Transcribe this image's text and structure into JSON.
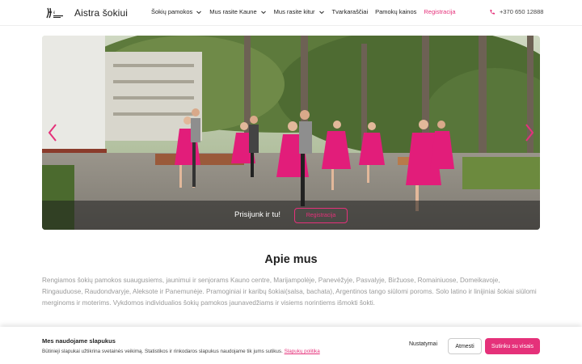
{
  "header": {
    "site_name": "Aistra šokiui",
    "nav": [
      {
        "label": "Šokių pamokos",
        "dropdown": true
      },
      {
        "label": "Mus rasite Kaune",
        "dropdown": true
      },
      {
        "label": "Mus rasite kitur",
        "dropdown": true
      },
      {
        "label": "Tvarkaraščiai",
        "dropdown": false
      },
      {
        "label": "Pamokų kainos",
        "dropdown": false
      },
      {
        "label": "Registracija",
        "dropdown": false,
        "accent": true
      }
    ],
    "phone": "+370 650 12888"
  },
  "hero": {
    "caption": "Prisijunk ir tu!",
    "button_label": "Registracija"
  },
  "about": {
    "title": "Apie mus",
    "text": "Rengiamos šokių pamokos suaugusiems, jaunimui ir senjorams Kauno centre, Marijampolėje, Panevėžyje, Pasvalyje, Biržuose, Romainiuose, Domeikavoje, Ringauduose, Raudondvaryje, Aleksote ir Panemunėje. Pramoginiai ir karibų šokiai(salsa, bachata), Argentinos tango siūlomi poroms. Solo latino ir linijiniai šokiai siūlomi merginoms ir moterims. Vykdomos individualios šokių pamokos jaunavedžiams ir visiems norintiems išmokti šokti."
  },
  "cookie": {
    "title": "Mes naudojame slapukus",
    "text": "Būtinieji slapukai užtikrina svetainės veikimą. Statistikos ir rinkodaros slapukus naudojame tik jums sutikus.",
    "link": "Slapukų politika",
    "settings_label": "Nustatymai",
    "decline_label": "Atmesti",
    "accept_label": "Sutinku su visais"
  },
  "colors": {
    "accent": "#e5317a"
  },
  "icons": [
    "logo-icon",
    "chevron-down-icon",
    "phone-icon",
    "arrow-left-icon",
    "arrow-right-icon"
  ]
}
